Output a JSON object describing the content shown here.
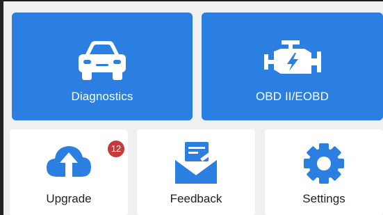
{
  "colors": {
    "tile_blue": "#2b7fe0",
    "tile_white": "#ffffff",
    "icon_blue": "#2b7fe0",
    "badge_red": "#c83a3a",
    "background": "#f0f0f0"
  },
  "tiles": {
    "diagnostics": {
      "label": "Diagnostics",
      "icon": "car-icon"
    },
    "obd": {
      "label": "OBD II/EOBD",
      "icon": "engine-icon"
    },
    "upgrade": {
      "label": "Upgrade",
      "icon": "cloud-upload-icon",
      "badge": "12"
    },
    "feedback": {
      "label": "Feedback",
      "icon": "envelope-note-icon"
    },
    "settings": {
      "label": "Settings",
      "icon": "gear-icon"
    }
  }
}
